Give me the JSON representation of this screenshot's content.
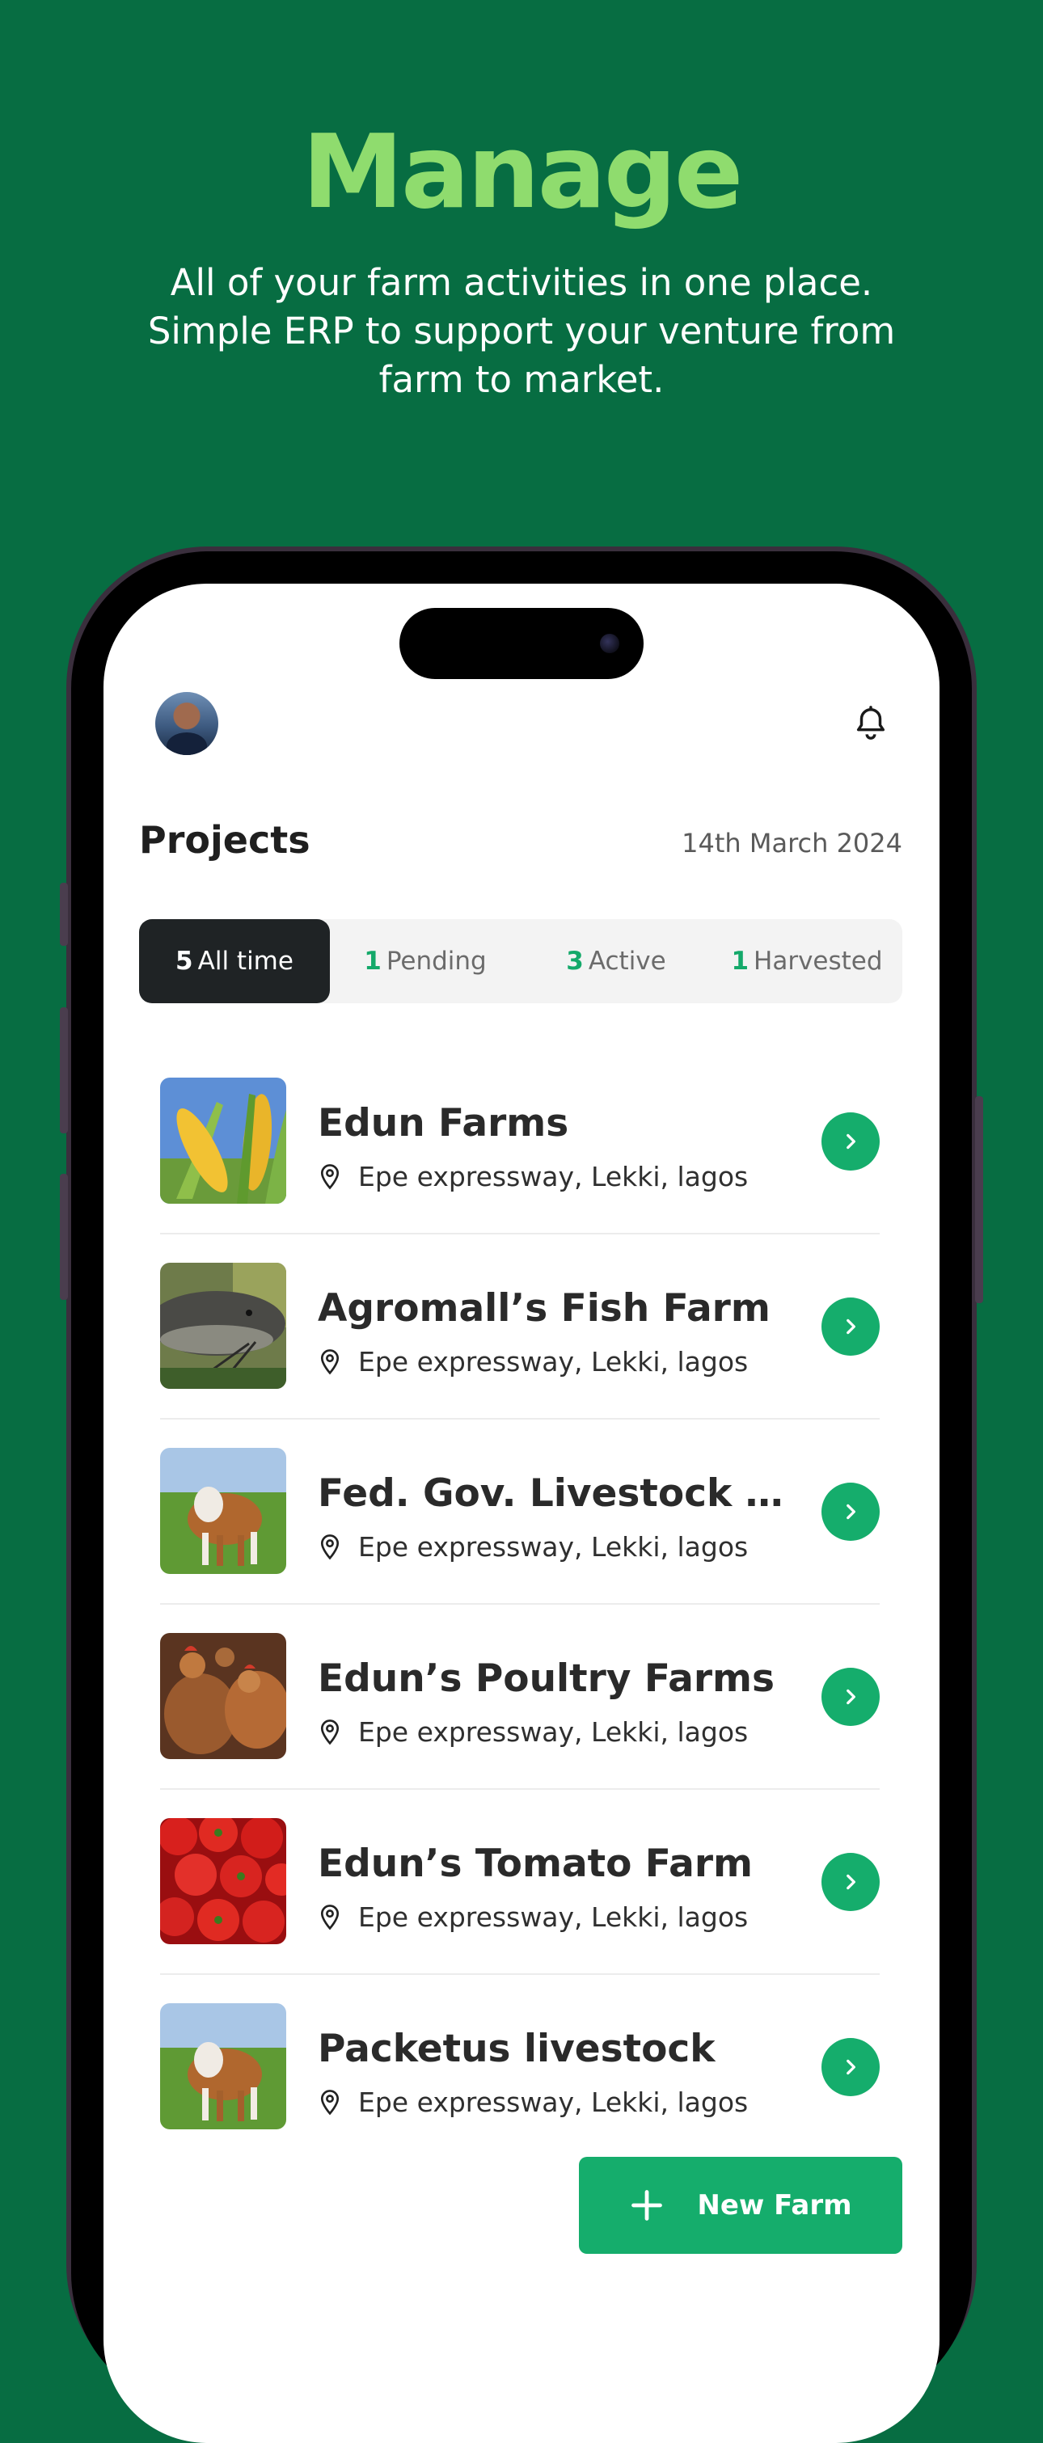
{
  "hero": {
    "title": "Manage",
    "subtitle": "All of your farm activities in one place. Simple ERP to support your venture from farm to market."
  },
  "header": {
    "avatar_icon": "user-avatar",
    "bell_icon": "bell-icon"
  },
  "projects": {
    "title": "Projects",
    "date": "14th March 2024"
  },
  "tabs": [
    {
      "count": "5",
      "label": "All time",
      "active": true
    },
    {
      "count": "1",
      "label": "Pending",
      "active": false
    },
    {
      "count": "3",
      "label": "Active",
      "active": false
    },
    {
      "count": "1",
      "label": "Harvested",
      "active": false
    }
  ],
  "farms": [
    {
      "name": "Edun Farms",
      "location": "Epe expressway, Lekki, lagos",
      "image": "corn"
    },
    {
      "name": "Agromall’s Fish Farm",
      "location": "Epe expressway, Lekki, lagos",
      "image": "catfish"
    },
    {
      "name": "Fed. Gov. Livestock Init...",
      "location": "Epe expressway, Lekki, lagos",
      "image": "cow"
    },
    {
      "name": "Edun’s Poultry Farms",
      "location": "Epe expressway, Lekki, lagos",
      "image": "chickens"
    },
    {
      "name": "Edun’s Tomato Farm",
      "location": "Epe expressway, Lekki, lagos",
      "image": "tomatoes"
    },
    {
      "name": "Packetus livestock",
      "location": "Epe expressway, Lekki, lagos",
      "image": "cow"
    }
  ],
  "actions": {
    "new_farm_label": "New Farm"
  },
  "colors": {
    "background": "#076D42",
    "accent": "#15AD6C",
    "headline": "#8FDC6E"
  }
}
